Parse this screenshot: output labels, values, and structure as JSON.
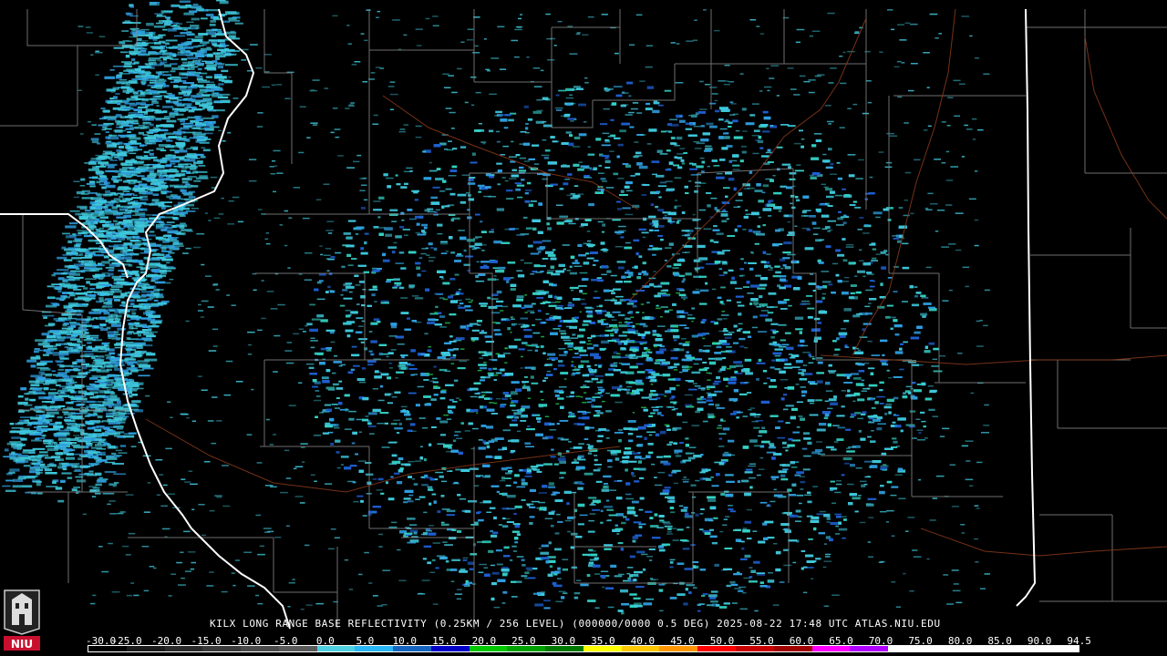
{
  "caption": {
    "text": "KILX LONG RANGE BASE REFLECTIVITY (0.25KM / 256 LEVEL) (000000/0000 0.5 DEG) 2025-08-22 17:48 UTC  ATLAS.NIU.EDU"
  },
  "scale": {
    "labels": [
      "-30.0",
      "-25.0",
      "-20.0",
      "-15.0",
      "-10.0",
      "-5.0",
      "0.0",
      "5.0",
      "10.0",
      "15.0",
      "20.0",
      "25.0",
      "30.0",
      "35.0",
      "40.0",
      "45.0",
      "50.0",
      "55.0",
      "60.0",
      "65.0",
      "70.0",
      "75.0",
      "80.0",
      "85.0",
      "90.0",
      "94.5"
    ],
    "colors": [
      "#000000",
      "#1a1a1a",
      "#2a2a2a",
      "#3a3a3a",
      "#4a4a4a",
      "#5a5a5a",
      "#4dd0e1",
      "#29b6f6",
      "#1565c0",
      "#0000c8",
      "#00c800",
      "#00a000",
      "#007800",
      "#ffff00",
      "#ffc800",
      "#ff9600",
      "#ff0000",
      "#c80000",
      "#a00000",
      "#ff00ff",
      "#b000ff",
      "#ffffff",
      "#ffffff",
      "#ffffff",
      "#ffffff",
      "#ffffff"
    ]
  },
  "logo": {
    "text": "NIU"
  },
  "colors": {
    "echo_light": "#3ec8dc",
    "echo_mid": "#2f9fe0",
    "echo_dark": "#1e5fd0",
    "county": "#8a8a8a",
    "road": "#8b3a1a",
    "state": "#ffffff"
  }
}
